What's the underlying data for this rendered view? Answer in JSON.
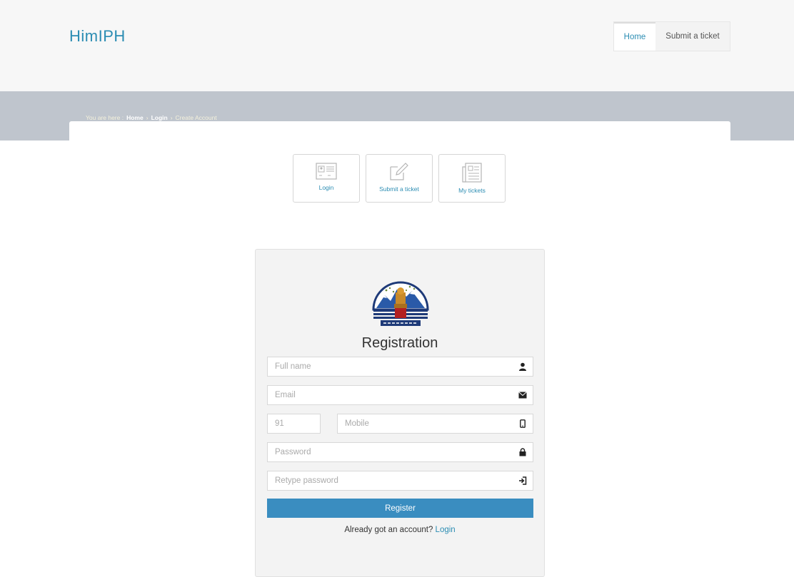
{
  "header": {
    "logo": "HimIPH",
    "nav": [
      {
        "label": "Home"
      },
      {
        "label": "Submit a ticket"
      }
    ]
  },
  "breadcrumb": {
    "prefix": "You are here :",
    "home": "Home",
    "login": "Login",
    "current": "Create Account"
  },
  "tiles": [
    {
      "label": "Login",
      "icon": "id-card-icon"
    },
    {
      "label": "Submit a ticket",
      "icon": "edit-icon"
    },
    {
      "label": "My tickets",
      "icon": "newspaper-icon"
    }
  ],
  "registration": {
    "title": "Registration",
    "fields": {
      "full_name": {
        "placeholder": "Full name",
        "icon": "user-icon"
      },
      "email": {
        "placeholder": "Email",
        "icon": "envelope-icon"
      },
      "country_code": {
        "placeholder": "91"
      },
      "mobile": {
        "placeholder": "Mobile",
        "icon": "phone-icon"
      },
      "password": {
        "placeholder": "Password",
        "icon": "lock-icon"
      },
      "retype_password": {
        "placeholder": "Retype password",
        "icon": "sign-in-icon"
      }
    },
    "register_label": "Register",
    "already_text": "Already got an account?",
    "login_link": "Login"
  },
  "colors": {
    "accent": "#2c8db3",
    "button": "#3a8dc0",
    "band": "#bfc5cd"
  }
}
